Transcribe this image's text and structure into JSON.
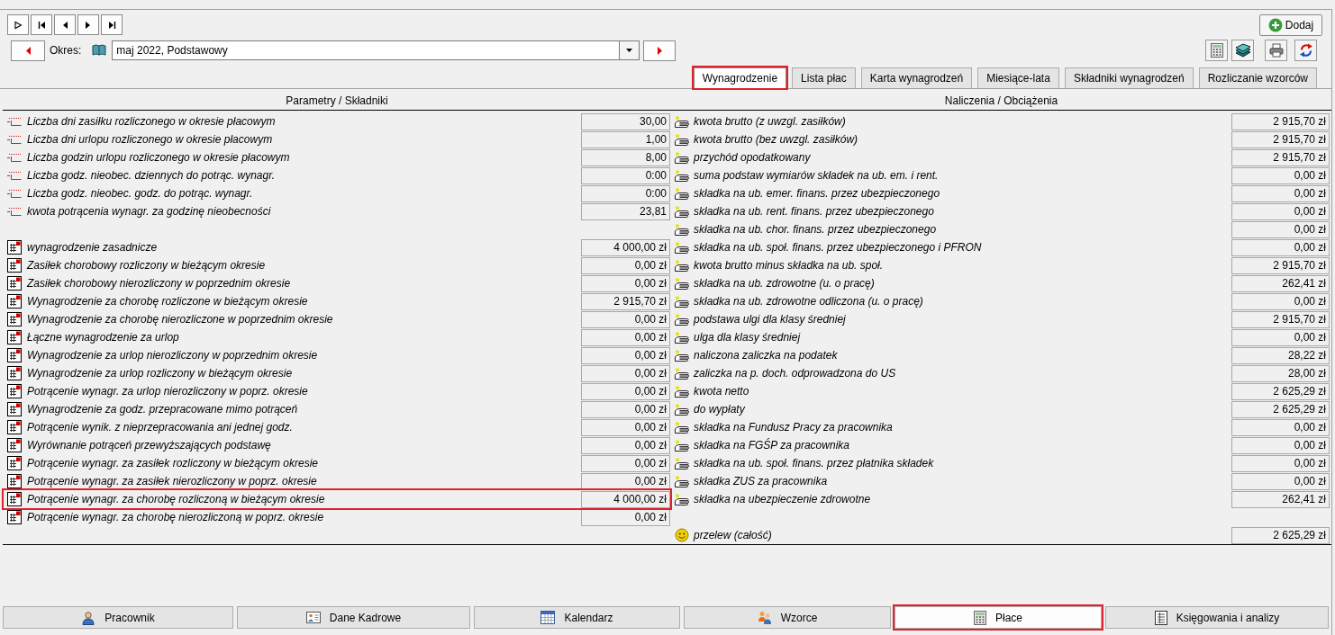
{
  "toolbar": {
    "add_button": {
      "label": "Dodaj"
    }
  },
  "period": {
    "label": "Okres:",
    "value": "maj 2022, Podstawowy"
  },
  "tabs": [
    {
      "label": "Wynagrodzenie",
      "selected": true,
      "highlighted": true
    },
    {
      "label": "Lista płac",
      "selected": false,
      "highlighted": false
    },
    {
      "label": "Karta wynagrodzeń",
      "selected": false,
      "highlighted": false
    },
    {
      "label": "Miesiące-lata",
      "selected": false,
      "highlighted": false
    },
    {
      "label": "Składniki wynagrodzeń",
      "selected": false,
      "highlighted": false
    },
    {
      "label": "Rozliczanie wzorców",
      "selected": false,
      "highlighted": false
    }
  ],
  "parameters": {
    "header": "Parametry / Składniki",
    "settings": [
      {
        "label": "Liczba dni zasiłku rozliczonego w okresie płacowym",
        "value": "30,00"
      },
      {
        "label": "Liczba dni urlopu rozliczonego w okresie płacowym",
        "value": "1,00"
      },
      {
        "label": "Liczba godzin urlopu rozliczonego w okresie płacowym",
        "value": "8,00"
      },
      {
        "label": "Liczba godz. nieobec. dziennych do potrąc. wynagr.",
        "value": "0:00"
      },
      {
        "label": "Liczba godz. nieobec. godz. do potrąc. wynagr.",
        "value": "0:00"
      },
      {
        "label": "kwota potrącenia wynagr. za godzinę nieobecności",
        "value": "23,81"
      }
    ],
    "components": [
      {
        "label": "wynagrodzenie zasadnicze",
        "value": "4 000,00 zł",
        "highlighted": false
      },
      {
        "label": "Zasiłek chorobowy rozliczony w bieżącym okresie",
        "value": "0,00 zł",
        "highlighted": false
      },
      {
        "label": "Zasiłek chorobowy nierozliczony w poprzednim okresie",
        "value": "0,00 zł",
        "highlighted": false
      },
      {
        "label": "Wynagrodzenie za chorobę rozliczone w bieżącym okresie",
        "value": "2 915,70 zł",
        "highlighted": false
      },
      {
        "label": "Wynagrodzenie za chorobę nierozliczone w poprzednim okresie",
        "value": "0,00 zł",
        "highlighted": false
      },
      {
        "label": "Łączne wynagrodzenie za urlop",
        "value": "0,00 zł",
        "highlighted": false
      },
      {
        "label": "Wynagrodzenie za urlop nierozliczony w poprzednim okresie",
        "value": "0,00 zł",
        "highlighted": false
      },
      {
        "label": "Wynagrodzenie za urlop rozliczony w bieżącym okresie",
        "value": "0,00 zł",
        "highlighted": false
      },
      {
        "label": "Potrącenie wynagr. za urlop nierozliczony w poprz. okresie",
        "value": "0,00 zł",
        "highlighted": false
      },
      {
        "label": "Wynagrodzenie za godz. przepracowane mimo potrąceń",
        "value": "0,00 zł",
        "highlighted": false
      },
      {
        "label": "Potrącenie wynik. z nieprzepracowania ani jednej godz.",
        "value": "0,00 zł",
        "highlighted": false
      },
      {
        "label": "Wyrównanie potrąceń przewyższających podstawę",
        "value": "0,00 zł",
        "highlighted": false
      },
      {
        "label": "Potrącenie wynagr. za zasiłek rozliczony w bieżącym okresie",
        "value": "0,00 zł",
        "highlighted": false
      },
      {
        "label": "Potrącenie wynagr. za zasiłek nierozliczony w poprz. okresie",
        "value": "0,00 zł",
        "highlighted": false
      },
      {
        "label": "Potrącenie wynagr. za chorobę rozliczoną w bieżącym okresie",
        "value": "4 000,00 zł",
        "highlighted": true
      },
      {
        "label": "Potrącenie wynagr. za chorobę nierozliczoną w poprz. okresie",
        "value": "0,00 zł",
        "highlighted": false
      }
    ]
  },
  "charges": {
    "header": "Naliczenia / Obciążenia",
    "rows": [
      {
        "label": "kwota brutto (z uwzgl. zasiłków)",
        "value": "2 915,70 zł"
      },
      {
        "label": "kwota brutto (bez uwzgl. zasiłków)",
        "value": "2 915,70 zł"
      },
      {
        "label": "przychód opodatkowany",
        "value": "2 915,70 zł"
      },
      {
        "label": "suma podstaw wymiarów składek na ub. em. i rent.",
        "value": "0,00 zł"
      },
      {
        "label": "składka na ub. emer. finans. przez ubezpieczonego",
        "value": "0,00 zł"
      },
      {
        "label": "składka na ub. rent. finans. przez ubezpieczonego",
        "value": "0,00 zł"
      },
      {
        "label": "składka na ub. chor. finans. przez ubezpieczonego",
        "value": "0,00 zł"
      },
      {
        "label": "składka na ub. społ. finans. przez ubezpieczonego i PFRON",
        "value": "0,00 zł"
      },
      {
        "label": "kwota brutto minus składka na ub. społ.",
        "value": "2 915,70 zł"
      },
      {
        "label": "składka na ub. zdrowotne (u. o pracę)",
        "value": "262,41 zł"
      },
      {
        "label": "składka na ub. zdrowotne odliczona (u. o pracę)",
        "value": "0,00 zł"
      },
      {
        "label": "podstawa ulgi dla klasy średniej",
        "value": "2 915,70 zł"
      },
      {
        "label": "ulga dla klasy średniej",
        "value": "0,00 zł"
      },
      {
        "label": "naliczona zaliczka na podatek",
        "value": "28,22 zł"
      },
      {
        "label": "zaliczka na p. doch. odprowadzona do US",
        "value": "28,00 zł"
      },
      {
        "label": "kwota netto",
        "value": "2 625,29 zł"
      },
      {
        "label": "do wypłaty",
        "value": "2 625,29 zł"
      },
      {
        "label": "składka na Fundusz Pracy za pracownika",
        "value": "0,00 zł"
      },
      {
        "label": "składka na FGŚP za pracownika",
        "value": "0,00 zł"
      },
      {
        "label": "składka na ub. społ. finans. przez płatnika składek",
        "value": "0,00 zł"
      },
      {
        "label": "składka ZUS za pracownika",
        "value": "0,00 zł"
      },
      {
        "label": "składka na ubezpieczenie zdrowotne",
        "value": "262,41 zł"
      }
    ],
    "total": {
      "label": "przelew (całość)",
      "value": "2 625,29 zł"
    }
  },
  "modules": [
    {
      "label": "Pracownik",
      "selected": false,
      "highlighted": false
    },
    {
      "label": "Dane Kadrowe",
      "selected": false,
      "highlighted": false
    },
    {
      "label": "Kalendarz",
      "selected": false,
      "highlighted": false
    },
    {
      "label": "Wzorce",
      "selected": false,
      "highlighted": false
    },
    {
      "label": "Płace",
      "selected": true,
      "highlighted": true
    },
    {
      "label": "Księgowania i analizy",
      "selected": false,
      "highlighted": false
    }
  ]
}
